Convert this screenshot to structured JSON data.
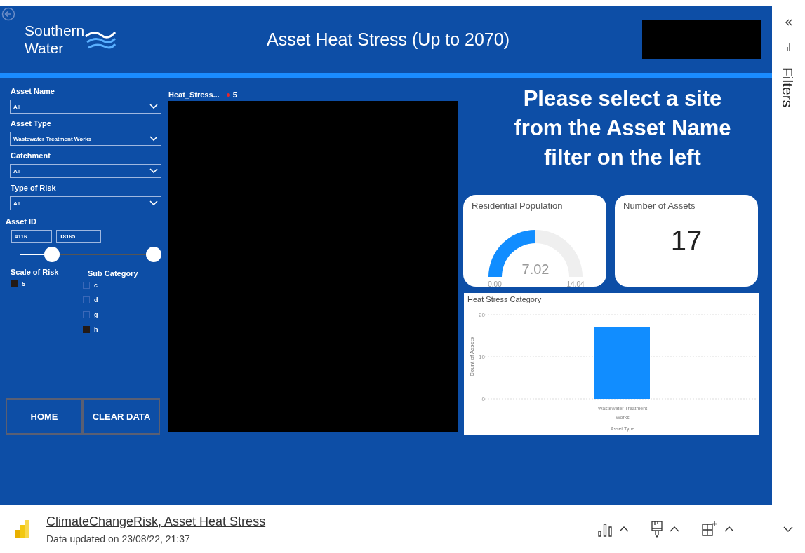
{
  "header": {
    "logo": [
      "Southern",
      "Water"
    ],
    "title": "Asset Heat Stress (Up to 2070)"
  },
  "slicers": [
    {
      "label": "Asset Name",
      "value": "All"
    },
    {
      "label": "Asset Type",
      "value": "Wastewater Treatment Works"
    },
    {
      "label": "Catchment",
      "value": "All"
    },
    {
      "label": "Type of Risk",
      "value": "All"
    }
  ],
  "asset_id": {
    "label": "Asset ID",
    "min": "4116",
    "max": "18165",
    "level": 0.24
  },
  "scale_of_risk": {
    "label": "Scale of Risk",
    "items": [
      {
        "label": "5",
        "checked": true
      }
    ]
  },
  "sub_category": {
    "label": "Sub Category",
    "items": [
      {
        "label": "c",
        "checked": false
      },
      {
        "label": "d",
        "checked": false
      },
      {
        "label": "g",
        "checked": false
      },
      {
        "label": "h",
        "checked": true
      }
    ]
  },
  "buttons": [
    "HOME",
    "CLEAR DATA"
  ],
  "map_legend": {
    "title": "Heat_Stress...",
    "items": [
      {
        "label": "5",
        "color": "#e8262b"
      }
    ]
  },
  "prompt": "Please select a site from the Asset Name filter on the left",
  "gauge": {
    "title": "Residential Population",
    "value": "7.02",
    "min": "0.00",
    "max": "14.04"
  },
  "card": {
    "title": "Number of Assets",
    "value": "17"
  },
  "chart": {
    "chart_data": {
      "type": "bar",
      "title": "Heat Stress Category",
      "xlabel": "Asset Type",
      "ylabel": "Count of Assets",
      "categories": [
        "Wastewater Treatment Works"
      ],
      "values": [
        17
      ],
      "ylim": [
        0,
        20
      ],
      "yticks": [
        0,
        10,
        20
      ]
    }
  },
  "filters_pane": {
    "label": "Filters"
  },
  "footer": {
    "report": "ClimateChangeRisk, Asset Heat Stress",
    "updated": "Data updated on 23/08/22, 21:37"
  }
}
